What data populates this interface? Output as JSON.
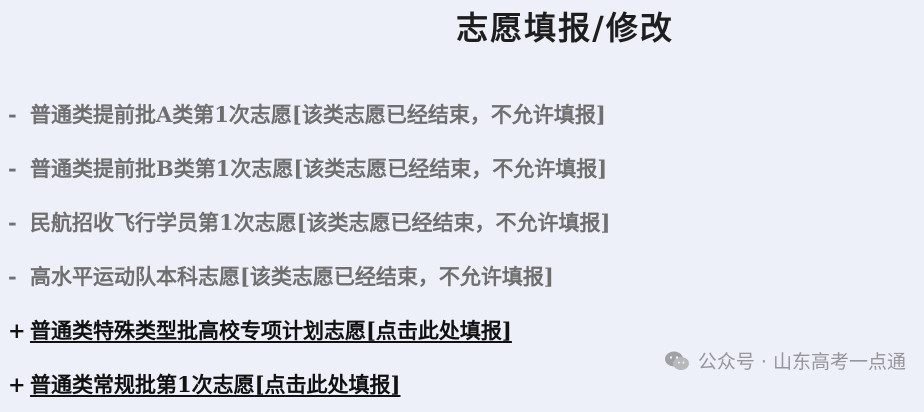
{
  "page": {
    "title": "志愿填报/修改"
  },
  "batches": [
    {
      "prefix": "-",
      "name": "普通类提前批A类第1次志愿",
      "status": "[该类志愿已经结束，不允许填报]",
      "state": "closed"
    },
    {
      "prefix": "-",
      "name": "普通类提前批B类第1次志愿",
      "status": "[该类志愿已经结束，不允许填报]",
      "state": "closed"
    },
    {
      "prefix": "-",
      "name": "民航招收飞行学员第1次志愿",
      "status": "[该类志愿已经结束，不允许填报]",
      "state": "closed"
    },
    {
      "prefix": "-",
      "name": "高水平运动队本科志愿",
      "status": "[该类志愿已经结束，不允许填报]",
      "state": "closed"
    },
    {
      "prefix": "+",
      "name": "普通类特殊类型批高校专项计划志愿",
      "status": "[点击此处填报]",
      "state": "open"
    },
    {
      "prefix": "+",
      "name": "普通类常规批第1次志愿",
      "status": "[点击此处填报]",
      "state": "open"
    }
  ],
  "watermark": {
    "icon": "wechat-icon",
    "text": "公众号 · 山东高考一点通"
  }
}
